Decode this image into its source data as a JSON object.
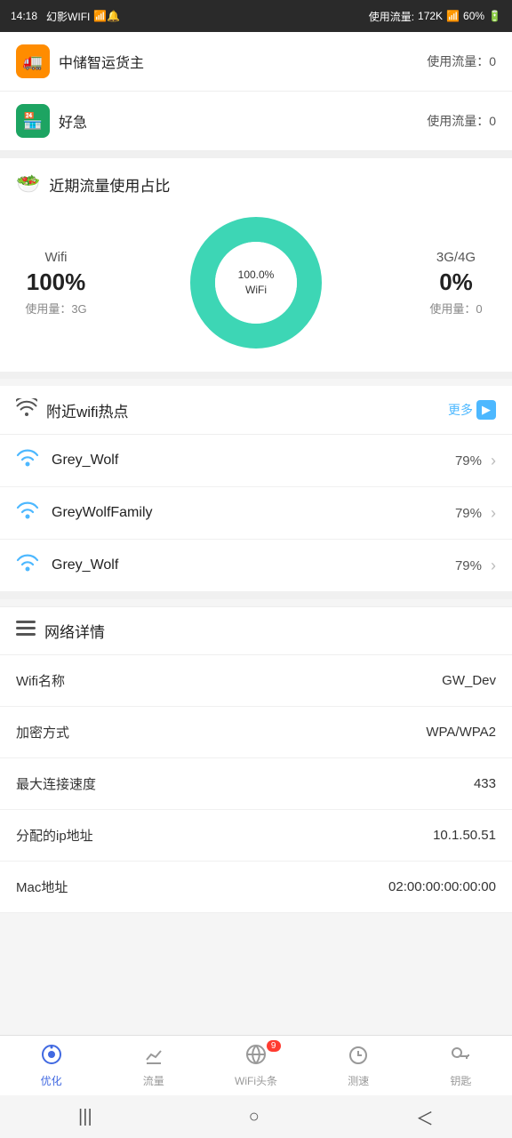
{
  "statusBar": {
    "time": "14:18",
    "appName": "幻影WIFI",
    "trafficLabel": "使用流量:",
    "trafficValue": "172K",
    "battery": "60%"
  },
  "apps": [
    {
      "icon": "🚛",
      "iconBg": "#ff8c00",
      "name": "中储智运货主",
      "trafficLabel": "使用流量：",
      "trafficValue": "0"
    },
    {
      "icon": "🏪",
      "iconBg": "#1da462",
      "name": "好急",
      "trafficLabel": "使用流量：",
      "trafficValue": "0"
    }
  ],
  "trafficSection": {
    "icon": "🥗",
    "title": "近期流量使用占比",
    "wifi": {
      "label": "Wifi",
      "pct": "100%",
      "usage": "使用量：3G"
    },
    "cellular": {
      "label": "3G/4G",
      "pct": "0%",
      "usage": "使用量：0"
    },
    "donut": {
      "centerLine1": "100.0%",
      "centerLine2": "WiFi",
      "wifiColor": "#3dd6b5",
      "otherColor": "#e0e0e0"
    }
  },
  "wifiHotspots": {
    "icon": "📶",
    "title": "附近wifi热点",
    "moreLabel": "更多",
    "items": [
      {
        "name": "Grey_Wolf",
        "strength": "79%",
        "icon": "wifi"
      },
      {
        "name": "GreyWolfFamily",
        "strength": "79%",
        "icon": "wifi"
      },
      {
        "name": "Grey_Wolf",
        "strength": "79%",
        "icon": "wifi"
      }
    ]
  },
  "networkDetails": {
    "icon": "≡",
    "title": "网络详情",
    "items": [
      {
        "key": "Wifi名称",
        "value": "GW_Dev"
      },
      {
        "key": "加密方式",
        "value": "WPA/WPA2"
      },
      {
        "key": "最大连接速度",
        "value": "433"
      },
      {
        "key": "分配的ip地址",
        "value": "10.1.50.51"
      },
      {
        "key": "Mac地址",
        "value": "02:00:00:00:00:00"
      }
    ]
  },
  "bottomNav": [
    {
      "icon": "🎯",
      "label": "优化",
      "active": true,
      "badge": null
    },
    {
      "icon": "📊",
      "label": "流量",
      "active": false,
      "badge": null
    },
    {
      "icon": "🌐",
      "label": "WiFi头条",
      "active": false,
      "badge": "9"
    },
    {
      "icon": "⏱",
      "label": "测速",
      "active": false,
      "badge": null
    },
    {
      "icon": "🔑",
      "label": "钥匙",
      "active": false,
      "badge": null
    }
  ],
  "sysNav": {
    "menu": "|||",
    "home": "○",
    "back": "＜"
  }
}
